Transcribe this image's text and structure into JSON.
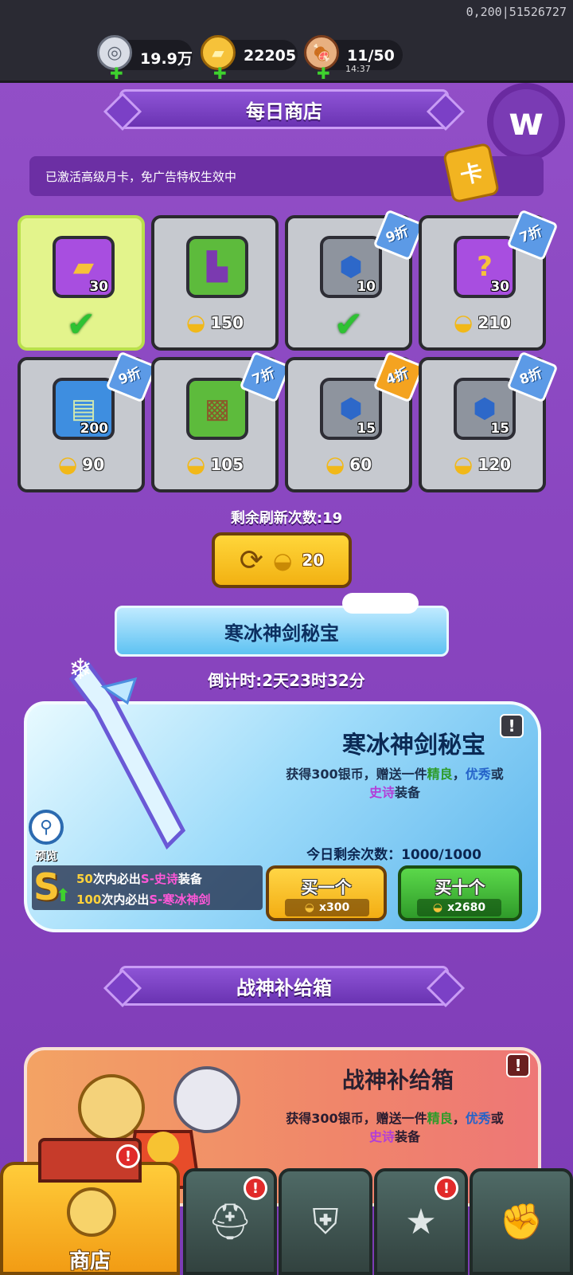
{
  "debug_text": "0,200|51526727",
  "resources": [
    {
      "icon": "silver-coin-icon",
      "value": "19.9万"
    },
    {
      "icon": "gold-ingot-icon",
      "value": "22205"
    },
    {
      "icon": "meat-stamina-icon",
      "value": "11/50",
      "timer": "14:37"
    }
  ],
  "daily_shop": {
    "title": "每日商店",
    "notice": "已激活高级月卡，免广告特权生效中",
    "items": [
      {
        "icon": "gold-ingot-icon",
        "qty": "30",
        "price": "",
        "discount": "",
        "purchased": true
      },
      {
        "icon": "boots-icon",
        "qty": "",
        "price": "150",
        "discount": ""
      },
      {
        "icon": "blue-gem-icon",
        "qty": "10",
        "price": "",
        "discount": "9折",
        "purchased": true
      },
      {
        "icon": "mystery-box-icon",
        "qty": "30",
        "price": "210",
        "discount": "7折"
      },
      {
        "icon": "scroll-map-icon",
        "qty": "200",
        "price": "90",
        "discount": "9折"
      },
      {
        "icon": "armor-icon",
        "qty": "",
        "price": "105",
        "discount": "7折"
      },
      {
        "icon": "gem-ring-icon",
        "qty": "15",
        "price": "60",
        "discount": "4折"
      },
      {
        "icon": "gem-boot-icon",
        "qty": "15",
        "price": "120",
        "discount": "8折"
      }
    ],
    "refresh_label": "剩余刷新次数:19",
    "refresh_cost": "20"
  },
  "ice_treasure": {
    "banner": "寒冰神剑秘宝",
    "countdown": "倒计时:2天23时32分",
    "title": "寒冰神剑秘宝",
    "desc_prefix": "获得300银币，赠送一件",
    "desc_q1": "精良",
    "desc_sep1": "，",
    "desc_q2": "优秀",
    "desc_sep2": "或",
    "desc_q3": "史诗",
    "desc_suffix": "装备",
    "remaining": "今日剩余次数：1000/1000",
    "buy_one_label": "买一个",
    "buy_one_cost": "x300",
    "buy_ten_label": "买十个",
    "buy_ten_cost": "x2680",
    "preview_label": "预览",
    "guarantee1_prefix": "50",
    "guarantee1_mid": "次内必出",
    "guarantee1_item": "S-史诗",
    "guarantee1_suffix": "装备",
    "guarantee2_prefix": "100",
    "guarantee2_mid": "次内必出",
    "guarantee2_item": "S-寒冰神剑"
  },
  "war_supply": {
    "banner": "战神补给箱",
    "title": "战神补给箱",
    "desc_prefix": "获得300银币，赠送一件",
    "desc_q1": "精良",
    "desc_sep1": "，",
    "desc_q2": "优秀",
    "desc_sep2": "或",
    "desc_q3": "史诗",
    "desc_suffix": "装备"
  },
  "nav": {
    "shop_label": "商店",
    "tabs": [
      "helmet-icon",
      "shield-swords-icon",
      "winged-star-icon",
      "fist-upgrade-icon"
    ]
  },
  "colors": {
    "accent": "#8a46bf",
    "gold": "#f2b112",
    "green": "#2f9b2a"
  }
}
